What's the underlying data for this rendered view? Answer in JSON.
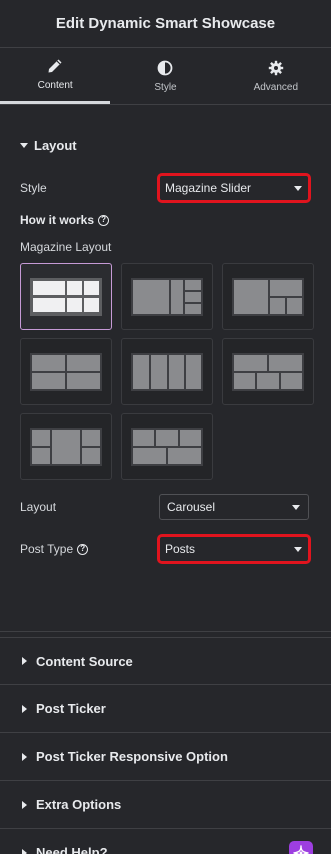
{
  "header": {
    "title": "Edit Dynamic Smart Showcase"
  },
  "tabs": [
    {
      "label": "Content",
      "icon": "pencil-icon",
      "active": true
    },
    {
      "label": "Style",
      "icon": "contrast-icon",
      "active": false
    },
    {
      "label": "Advanced",
      "icon": "gear-icon",
      "active": false
    }
  ],
  "layout_section": {
    "title": "Layout",
    "style_label": "Style",
    "style_value": "Magazine Slider",
    "how_it_works": "How it works",
    "magazine_layout_label": "Magazine Layout",
    "layout_label": "Layout",
    "layout_value": "Carousel",
    "post_type_label": "Post Type",
    "post_type_value": "Posts",
    "highlight_color": "#e0141e",
    "selected_layout_index": 0
  },
  "sections": [
    {
      "title": "Content Source"
    },
    {
      "title": "Post Ticker"
    },
    {
      "title": "Post Ticker Responsive Option"
    },
    {
      "title": "Extra Options"
    },
    {
      "title": "Need Help?"
    }
  ],
  "colors": {
    "background": "#26272b",
    "accent_purple": "#9d3ee0",
    "selected_border": "#c69ad6"
  }
}
